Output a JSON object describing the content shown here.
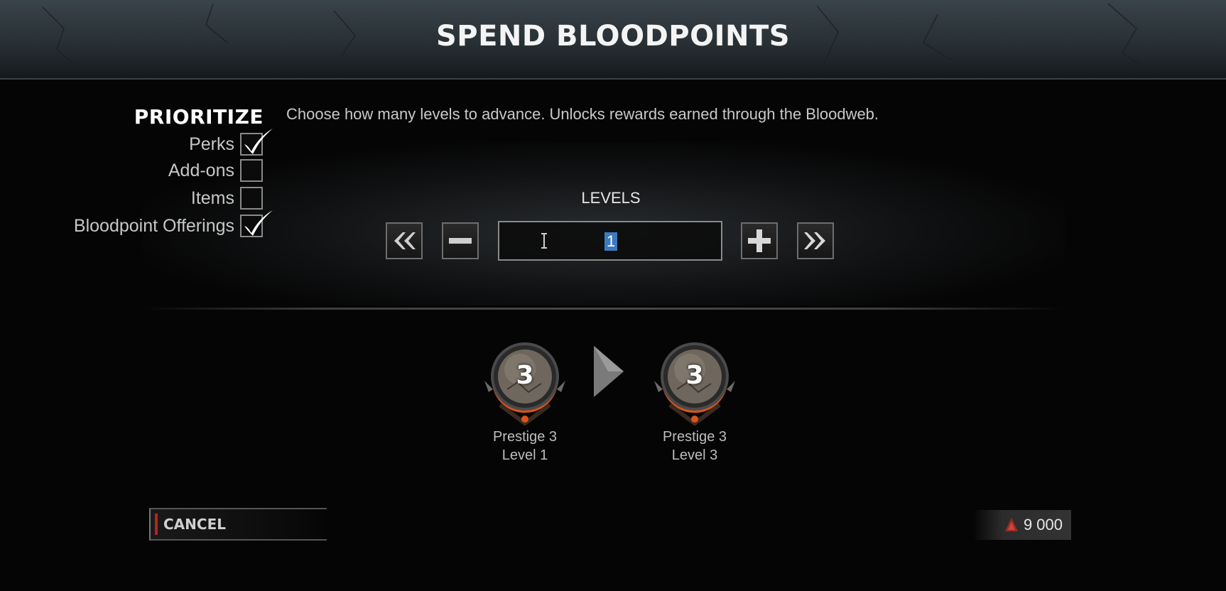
{
  "header": {
    "title": "SPEND BLOODPOINTS"
  },
  "prioritize": {
    "title": "PRIORITIZE",
    "options": [
      {
        "label": "Perks",
        "checked": true
      },
      {
        "label": "Add-ons",
        "checked": false
      },
      {
        "label": "Items",
        "checked": false
      },
      {
        "label": "Bloodpoint Offerings",
        "checked": true
      }
    ]
  },
  "description": "Choose how many levels to advance. Unlocks rewards earned through the Bloodweb.",
  "levels": {
    "label": "LEVELS",
    "value": "1",
    "icons": [
      "double-left-icon",
      "minus-icon",
      "plus-icon",
      "double-right-icon"
    ]
  },
  "progress": {
    "from": {
      "prestige_number": "3",
      "line1": "Prestige 3",
      "line2": "Level 1"
    },
    "to": {
      "prestige_number": "3",
      "line1": "Prestige 3",
      "line2": "Level 3"
    }
  },
  "footer": {
    "cancel_label": "CANCEL",
    "bloodpoints": "9 000"
  },
  "colors": {
    "accent_red": "#b3261e",
    "selection_blue": "#3b7bbf",
    "badge_ring_orange": "#d9541a"
  }
}
